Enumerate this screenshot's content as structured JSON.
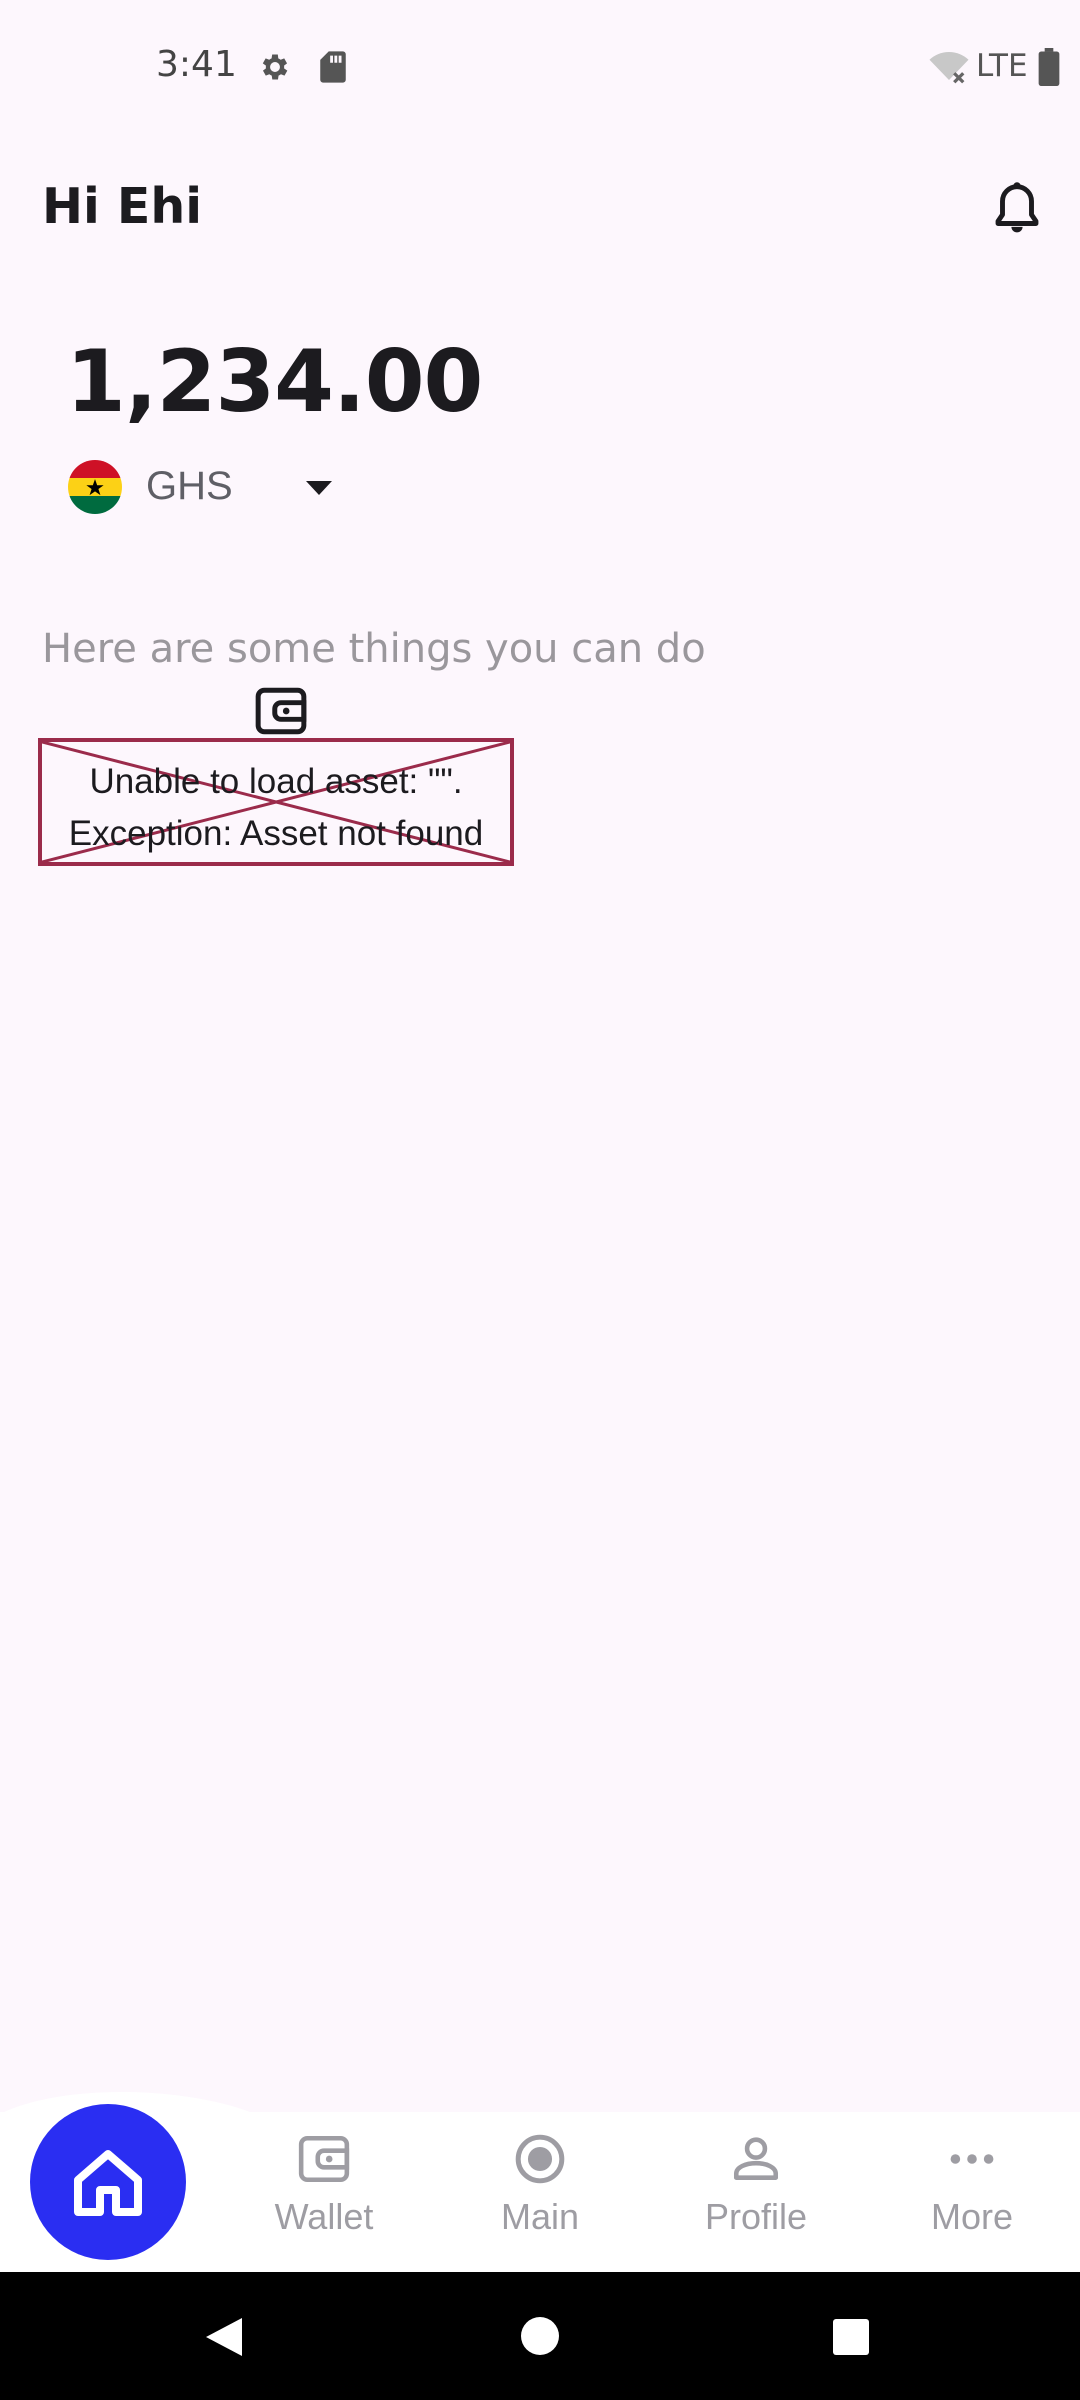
{
  "status_bar": {
    "time": "3:41",
    "network": "LTE",
    "icons": [
      "gear-icon",
      "sd-card-icon",
      "wifi-off-icon",
      "battery-icon"
    ]
  },
  "header": {
    "greeting": "Hi Ehi",
    "notification_icon": "bell-icon"
  },
  "balance": {
    "amount": "1,234.00",
    "currency_code": "GHS",
    "currency_flag": "ghana-flag-icon"
  },
  "actions": {
    "heading": "Here are some things you can do",
    "items": [
      {
        "icon": "wallet-icon",
        "error_line1": "Unable to load asset: \"\".",
        "error_line2": "Exception: Asset not found"
      }
    ]
  },
  "bottom_nav": {
    "active": "home",
    "items": [
      {
        "id": "home",
        "label": "",
        "icon": "home-icon"
      },
      {
        "id": "wallet",
        "label": "Wallet",
        "icon": "wallet-icon"
      },
      {
        "id": "main",
        "label": "Main",
        "icon": "radio-button-icon"
      },
      {
        "id": "profile",
        "label": "Profile",
        "icon": "person-icon"
      },
      {
        "id": "more",
        "label": "More",
        "icon": "more-horizontal-icon"
      }
    ]
  },
  "colors": {
    "background": "#fdf7fd",
    "accent": "#2a2ef2",
    "error_border": "#9b2b4b",
    "muted_text": "#9a979c"
  }
}
